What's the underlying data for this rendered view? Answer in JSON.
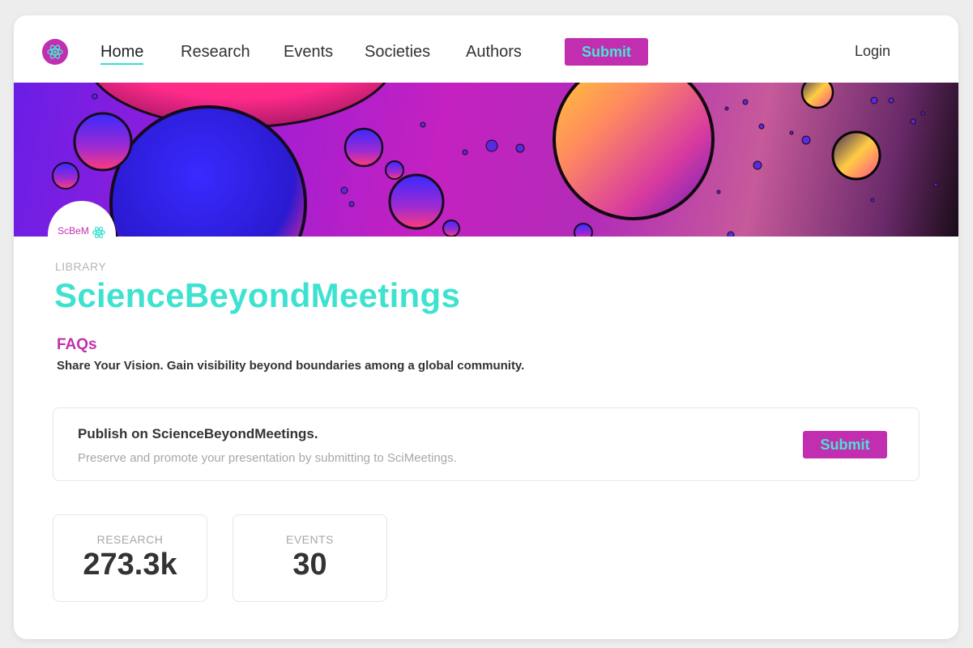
{
  "nav": {
    "links": [
      {
        "label": "Home"
      },
      {
        "label": "Research"
      },
      {
        "label": "Events"
      },
      {
        "label": "Societies"
      },
      {
        "label": "Authors"
      }
    ],
    "submit_label": "Submit",
    "login_label": "Login"
  },
  "badge": {
    "text": "ScBeM"
  },
  "header": {
    "eyebrow": "LIBRARY",
    "title": "ScienceBeyondMeetings"
  },
  "faq": {
    "label": "FAQs",
    "tagline": "Share Your Vision. Gain visibility beyond boundaries among a global community."
  },
  "publish_card": {
    "title": "Publish on ScienceBeyondMeetings.",
    "subtitle": "Preserve and promote your presentation by submitting to SciMeetings.",
    "submit_label": "Submit"
  },
  "stats": [
    {
      "label": "RESEARCH",
      "value": "273.3k"
    },
    {
      "label": "EVENTS",
      "value": "30"
    }
  ],
  "colors": {
    "brand_magenta": "#c12fb0",
    "accent_teal": "#3ee2d0"
  },
  "icons": {
    "logo": "atom-icon",
    "badge": "atom-icon"
  }
}
